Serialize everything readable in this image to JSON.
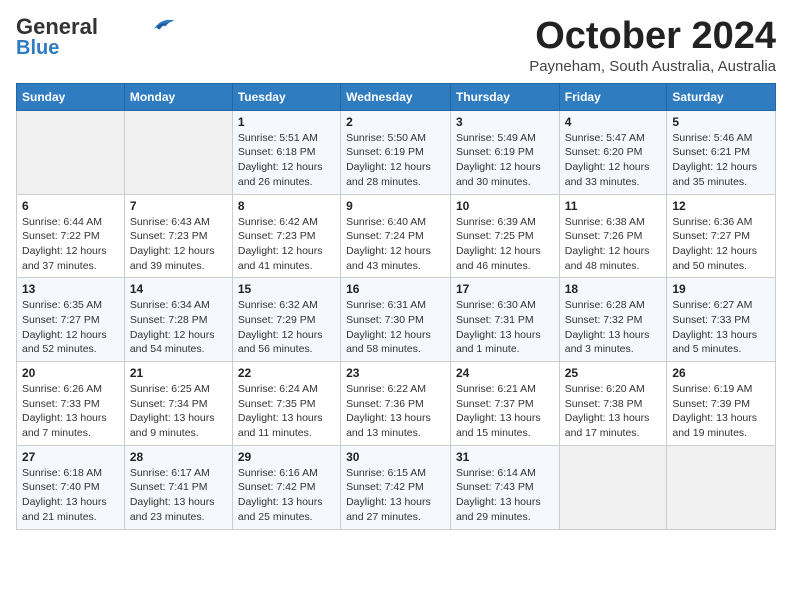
{
  "header": {
    "logo_line1": "General",
    "logo_line2": "Blue",
    "month": "October 2024",
    "location": "Payneham, South Australia, Australia"
  },
  "weekdays": [
    "Sunday",
    "Monday",
    "Tuesday",
    "Wednesday",
    "Thursday",
    "Friday",
    "Saturday"
  ],
  "weeks": [
    [
      {
        "day": "",
        "info": ""
      },
      {
        "day": "",
        "info": ""
      },
      {
        "day": "1",
        "info": "Sunrise: 5:51 AM\nSunset: 6:18 PM\nDaylight: 12 hours\nand 26 minutes."
      },
      {
        "day": "2",
        "info": "Sunrise: 5:50 AM\nSunset: 6:19 PM\nDaylight: 12 hours\nand 28 minutes."
      },
      {
        "day": "3",
        "info": "Sunrise: 5:49 AM\nSunset: 6:19 PM\nDaylight: 12 hours\nand 30 minutes."
      },
      {
        "day": "4",
        "info": "Sunrise: 5:47 AM\nSunset: 6:20 PM\nDaylight: 12 hours\nand 33 minutes."
      },
      {
        "day": "5",
        "info": "Sunrise: 5:46 AM\nSunset: 6:21 PM\nDaylight: 12 hours\nand 35 minutes."
      }
    ],
    [
      {
        "day": "6",
        "info": "Sunrise: 6:44 AM\nSunset: 7:22 PM\nDaylight: 12 hours\nand 37 minutes."
      },
      {
        "day": "7",
        "info": "Sunrise: 6:43 AM\nSunset: 7:23 PM\nDaylight: 12 hours\nand 39 minutes."
      },
      {
        "day": "8",
        "info": "Sunrise: 6:42 AM\nSunset: 7:23 PM\nDaylight: 12 hours\nand 41 minutes."
      },
      {
        "day": "9",
        "info": "Sunrise: 6:40 AM\nSunset: 7:24 PM\nDaylight: 12 hours\nand 43 minutes."
      },
      {
        "day": "10",
        "info": "Sunrise: 6:39 AM\nSunset: 7:25 PM\nDaylight: 12 hours\nand 46 minutes."
      },
      {
        "day": "11",
        "info": "Sunrise: 6:38 AM\nSunset: 7:26 PM\nDaylight: 12 hours\nand 48 minutes."
      },
      {
        "day": "12",
        "info": "Sunrise: 6:36 AM\nSunset: 7:27 PM\nDaylight: 12 hours\nand 50 minutes."
      }
    ],
    [
      {
        "day": "13",
        "info": "Sunrise: 6:35 AM\nSunset: 7:27 PM\nDaylight: 12 hours\nand 52 minutes."
      },
      {
        "day": "14",
        "info": "Sunrise: 6:34 AM\nSunset: 7:28 PM\nDaylight: 12 hours\nand 54 minutes."
      },
      {
        "day": "15",
        "info": "Sunrise: 6:32 AM\nSunset: 7:29 PM\nDaylight: 12 hours\nand 56 minutes."
      },
      {
        "day": "16",
        "info": "Sunrise: 6:31 AM\nSunset: 7:30 PM\nDaylight: 12 hours\nand 58 minutes."
      },
      {
        "day": "17",
        "info": "Sunrise: 6:30 AM\nSunset: 7:31 PM\nDaylight: 13 hours\nand 1 minute."
      },
      {
        "day": "18",
        "info": "Sunrise: 6:28 AM\nSunset: 7:32 PM\nDaylight: 13 hours\nand 3 minutes."
      },
      {
        "day": "19",
        "info": "Sunrise: 6:27 AM\nSunset: 7:33 PM\nDaylight: 13 hours\nand 5 minutes."
      }
    ],
    [
      {
        "day": "20",
        "info": "Sunrise: 6:26 AM\nSunset: 7:33 PM\nDaylight: 13 hours\nand 7 minutes."
      },
      {
        "day": "21",
        "info": "Sunrise: 6:25 AM\nSunset: 7:34 PM\nDaylight: 13 hours\nand 9 minutes."
      },
      {
        "day": "22",
        "info": "Sunrise: 6:24 AM\nSunset: 7:35 PM\nDaylight: 13 hours\nand 11 minutes."
      },
      {
        "day": "23",
        "info": "Sunrise: 6:22 AM\nSunset: 7:36 PM\nDaylight: 13 hours\nand 13 minutes."
      },
      {
        "day": "24",
        "info": "Sunrise: 6:21 AM\nSunset: 7:37 PM\nDaylight: 13 hours\nand 15 minutes."
      },
      {
        "day": "25",
        "info": "Sunrise: 6:20 AM\nSunset: 7:38 PM\nDaylight: 13 hours\nand 17 minutes."
      },
      {
        "day": "26",
        "info": "Sunrise: 6:19 AM\nSunset: 7:39 PM\nDaylight: 13 hours\nand 19 minutes."
      }
    ],
    [
      {
        "day": "27",
        "info": "Sunrise: 6:18 AM\nSunset: 7:40 PM\nDaylight: 13 hours\nand 21 minutes."
      },
      {
        "day": "28",
        "info": "Sunrise: 6:17 AM\nSunset: 7:41 PM\nDaylight: 13 hours\nand 23 minutes."
      },
      {
        "day": "29",
        "info": "Sunrise: 6:16 AM\nSunset: 7:42 PM\nDaylight: 13 hours\nand 25 minutes."
      },
      {
        "day": "30",
        "info": "Sunrise: 6:15 AM\nSunset: 7:42 PM\nDaylight: 13 hours\nand 27 minutes."
      },
      {
        "day": "31",
        "info": "Sunrise: 6:14 AM\nSunset: 7:43 PM\nDaylight: 13 hours\nand 29 minutes."
      },
      {
        "day": "",
        "info": ""
      },
      {
        "day": "",
        "info": ""
      }
    ]
  ]
}
